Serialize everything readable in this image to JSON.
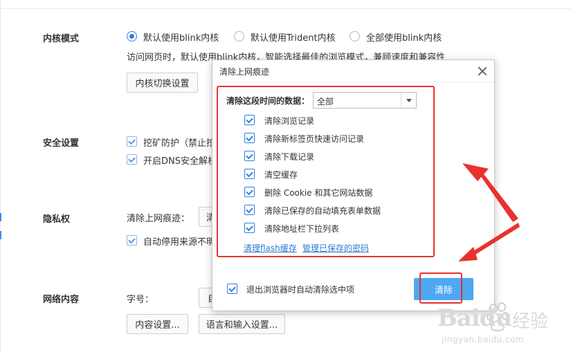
{
  "kernel": {
    "title": "内核模式",
    "options": [
      "默认使用blink内核",
      "默认使用Trident内核",
      "全部使用blink内核"
    ],
    "description": "访问网页时，默认使用blink内核，智能选择最佳的浏览模式，兼顾速度和兼容性",
    "switch_button": "内核切换设置"
  },
  "security": {
    "title": "安全设置",
    "items": [
      "挖矿防护（禁止挖",
      "开启DNS安全解析"
    ]
  },
  "privacy": {
    "title": "隐私权",
    "clear_label": "清除上网痕迹：",
    "clear_button_partial": "清",
    "auto_item": "自动停用来源不明"
  },
  "web_content": {
    "title": "网络内容",
    "font_size_label": "字号：",
    "font_select_partial": "自",
    "content_button": "内容设置...",
    "language_button": "语言和输入设置..."
  },
  "dialog": {
    "title": "清除上网痕迹",
    "period_label": "清除这段时间的数据：",
    "period_value": "全部",
    "items": [
      "清除浏览记录",
      "清除新标签页快速访问记录",
      "清除下载记录",
      "清空缓存",
      "删除 Cookie 和其它网站数据",
      "清除已保存的自动填充表单数据",
      "清除地址栏下拉列表"
    ],
    "link_flash": "清理flash缓存",
    "link_passwords": "管理已保存的密码",
    "exit_clear": "退出浏览器时自动清除选中项",
    "clear_button": "清除"
  },
  "watermark": {
    "brand": "Baidu",
    "brand_cn": "经验",
    "url": "jingyan.baidu.com"
  },
  "colors": {
    "accent": "#2f7fe0",
    "annotation_red": "#e8322b",
    "primary_button": "#4ea8f2",
    "link": "#2b7cd3"
  }
}
